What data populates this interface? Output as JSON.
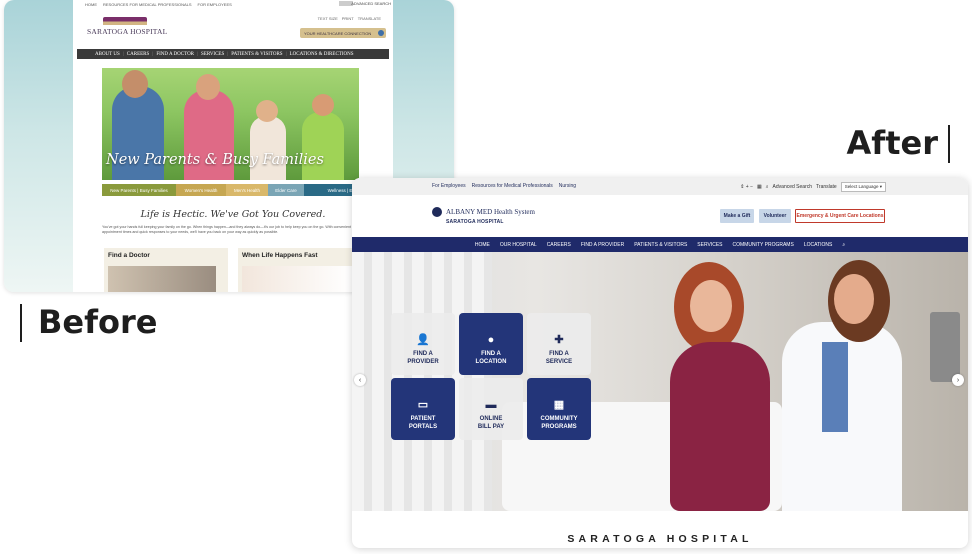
{
  "labels": {
    "after": "After",
    "before": "Before"
  },
  "before": {
    "top_links": [
      "HOME",
      "RESOURCES FOR MEDICAL PROFESSIONALS",
      "FOR EMPLOYEES"
    ],
    "advanced_search": "ADVANCED SEARCH",
    "logo": "SARATOGA HOSPITAL",
    "text_size": [
      "TEXT SIZE",
      "PRINT",
      "TRANSLATE"
    ],
    "connection_button": "YOUR HEALTHCARE CONNECTION",
    "nav": [
      "ABOUT US",
      "CAREERS",
      "FIND A DOCTOR",
      "SERVICES",
      "PATIENTS & VISITORS",
      "LOCATIONS & DIRECTIONS"
    ],
    "hero_title": "New Parents & Busy Families",
    "tabs": [
      {
        "label": "New Parents | Busy Families",
        "color": "#8a9a3c"
      },
      {
        "label": "Women's Health",
        "color": "#c6a752"
      },
      {
        "label": "Men's Health",
        "color": "#d9b86a"
      },
      {
        "label": "Elder Care",
        "color": "#7aa5b5"
      },
      {
        "label": "Wellness | Education",
        "color": "#2a6a86"
      }
    ],
    "tagline": "Life is Hectic. We've Got You Covered.",
    "body": "You've got your hands full keeping your family on the go. When things happen—and they always do—it's our job to help keep you on the go. With convenient appointment times and quick responses to your needs, we'll have you back on your way as quickly as possible.",
    "box1_title": "Find a Doctor",
    "box2_title": "When Life Happens Fast"
  },
  "after": {
    "util_left": [
      "For Employees",
      "Resources for Medical Professionals",
      "Nursing"
    ],
    "util_right": {
      "search": "Advanced Search",
      "translate": "Translate",
      "language": "Select Language"
    },
    "brand_system": "ALBANY MED Health System",
    "brand_sub": "SARATOGA HOSPITAL",
    "buttons": {
      "gift": "Make a Gift",
      "volunteer": "Volunteer",
      "er": "Emergency & Urgent Care Locations"
    },
    "nav": [
      "HOME",
      "OUR HOSPITAL",
      "CAREERS",
      "FIND A PROVIDER",
      "PATIENTS & VISITORS",
      "SERVICES",
      "COMMUNITY PROGRAMS",
      "LOCATIONS"
    ],
    "tiles": [
      {
        "label1": "FIND A",
        "label2": "PROVIDER",
        "icon": "doctor-icon"
      },
      {
        "label1": "FIND A",
        "label2": "LOCATION",
        "icon": "map-pin-icon"
      },
      {
        "label1": "FIND A",
        "label2": "SERVICE",
        "icon": "plus-icon"
      },
      {
        "label1": "PATIENT",
        "label2": "PORTALS",
        "icon": "monitor-icon"
      },
      {
        "label1": "ONLINE",
        "label2": "BILL PAY",
        "icon": "credit-card-icon"
      },
      {
        "label1": "COMMUNITY",
        "label2": "PROGRAMS",
        "icon": "calendar-icon"
      }
    ],
    "footer_title": "SARATOGA HOSPITAL"
  }
}
